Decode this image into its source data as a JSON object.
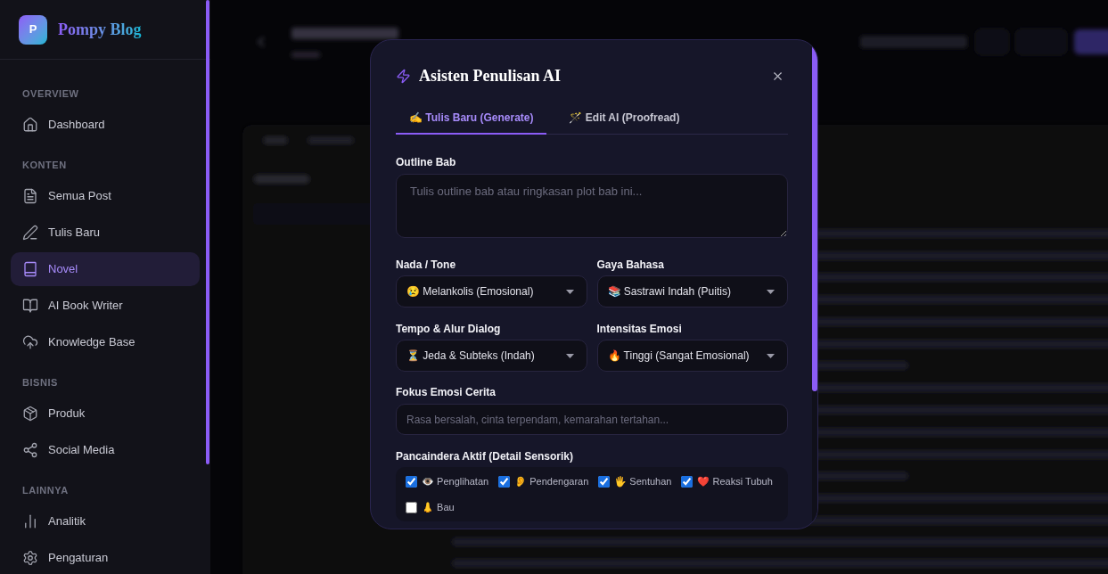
{
  "sidebar": {
    "brand": {
      "logo_letter": "P",
      "name": "Pompy Blog"
    },
    "sections": [
      {
        "heading": "OVERVIEW",
        "items": [
          {
            "label": "Dashboard",
            "selected": false
          }
        ]
      },
      {
        "heading": "KONTEN",
        "items": [
          {
            "label": "Semua Post",
            "selected": false
          },
          {
            "label": "Tulis Baru",
            "selected": false
          },
          {
            "label": "Novel",
            "selected": true
          },
          {
            "label": "AI Book Writer",
            "selected": false
          },
          {
            "label": "Knowledge Base",
            "selected": false
          }
        ]
      },
      {
        "heading": "BISNIS",
        "items": [
          {
            "label": "Produk",
            "selected": false
          },
          {
            "label": "Social Media",
            "selected": false
          }
        ]
      },
      {
        "heading": "LAINNYA",
        "items": [
          {
            "label": "Analitik",
            "selected": false
          },
          {
            "label": "Pengaturan",
            "selected": false
          }
        ]
      }
    ]
  },
  "dialog": {
    "title": "Asisten Penulisan AI",
    "tabs": [
      {
        "label": "✍️ Tulis Baru (Generate)",
        "selected": true
      },
      {
        "label": "🪄 Edit AI (Proofread)",
        "selected": false
      }
    ],
    "outline": {
      "label": "Outline Bab",
      "placeholder": "Tulis outline bab atau ringkasan plot bab ini..."
    },
    "selects": [
      {
        "label": "Nada / Tone",
        "value": "😢 Melankolis (Emosional)"
      },
      {
        "label": "Gaya Bahasa",
        "value": "📚 Sastrawi Indah (Puitis)"
      },
      {
        "label": "Tempo & Alur Dialog",
        "value": "⏳ Jeda & Subteks (Indah)"
      },
      {
        "label": "Intensitas Emosi",
        "value": "🔥 Tinggi (Sangat Emosional)"
      }
    ],
    "focus": {
      "label": "Fokus Emosi Cerita",
      "placeholder": "Rasa bersalah, cinta terpendam, kemarahan tertahan..."
    },
    "senses": {
      "label": "Pancaindera Aktif (Detail Sensorik)",
      "options": [
        {
          "label": "👁️ Penglihatan",
          "checked": true
        },
        {
          "label": "👂 Pendengaran",
          "checked": true
        },
        {
          "label": "🖐️ Sentuhan",
          "checked": true
        },
        {
          "label": "❤️ Reaksi Tubuh",
          "checked": true
        },
        {
          "label": "👃 Bau",
          "checked": false
        }
      ]
    }
  }
}
